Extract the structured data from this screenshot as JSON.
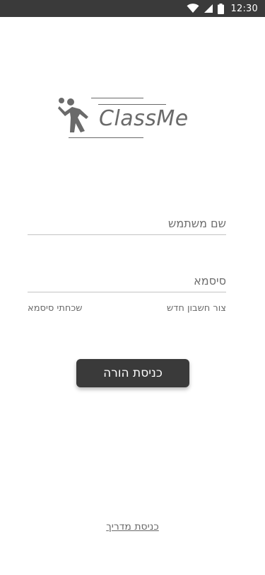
{
  "status_bar": {
    "time": "12:30",
    "icons": [
      "wifi-icon",
      "cellular-signal-icon",
      "battery-icon"
    ]
  },
  "logo": {
    "brand_name": "ClassMe",
    "icon": "volleyball-player-icon"
  },
  "form": {
    "username": {
      "placeholder": "שם משתמש",
      "value": ""
    },
    "password": {
      "placeholder": "סיסמא",
      "value": ""
    },
    "create_account_label": "צור חשבון חדש",
    "forgot_password_label": "שכחתי סיסמא",
    "parent_login_label": "כניסת הורה"
  },
  "footer": {
    "instructor_login_label": "כניסת מדריך"
  },
  "colors": {
    "status_bar_bg": "#3a3a3a",
    "button_bg": "#3a3a3a",
    "text_gray": "#6a6a6a",
    "underline_gray": "#c4c4c4",
    "background": "#ffffff"
  }
}
